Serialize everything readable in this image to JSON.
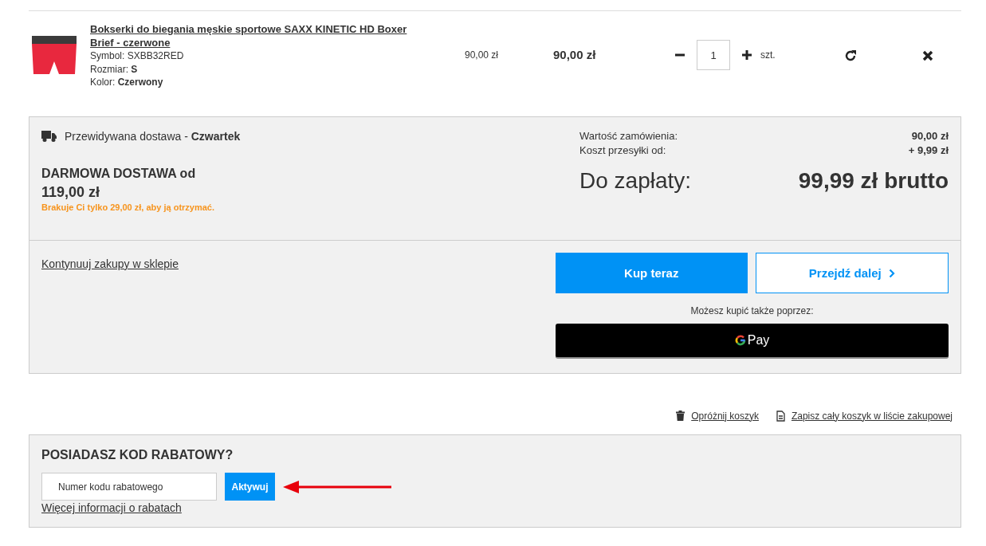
{
  "cart_item": {
    "name": "Bokserki do biegania męskie sportowe SAXX KINETIC HD Boxer Brief - czerwone",
    "details": [
      "Symbol: SXBB32RED",
      "Rozmiar: **S**",
      "Kolor: **Czerwony**"
    ],
    "unit_price": "90,00 zł",
    "total_price": "90,00 zł",
    "quantity": "1",
    "unit": "szt."
  },
  "summary": {
    "delivery": "Przewidywana dostawa - **Czwartek**",
    "free_shipping_title": "DARMOWA DOSTAWA od",
    "free_shipping_amount": "119,00 zł",
    "free_shipping_notice": "Brakuje Ci tylko 29,00 zł, aby ją otrzymać.",
    "totals": [
      {
        "label": "Wartość zamówienia:",
        "value": "90,00 zł"
      },
      {
        "label": "Koszt przesyłki od:",
        "value": "+ 9,99 zł"
      }
    ],
    "grand_label": "Do zapłaty:",
    "grand_value": "99,99 zł brutto",
    "continue_link": "Kontynuuj zakupy w sklepie",
    "buy_now": "Kup teraz",
    "next": "Przejdź dalej",
    "alt_pay_label": "Możesz kupić także poprzez:",
    "gpay": "Pay"
  },
  "cart_links": [
    {
      "kind": "trash",
      "label": "Opróżnij koszyk"
    },
    {
      "kind": "document",
      "label": "Zapisz cały koszyk w liście zakupowej"
    }
  ],
  "discount": {
    "title": "POSIADASZ KOD RABATOWY?",
    "placeholder": "Numer kodu rabatowego",
    "button": "Aktywuj",
    "info_link": "Więcej informacji o rabatach"
  }
}
